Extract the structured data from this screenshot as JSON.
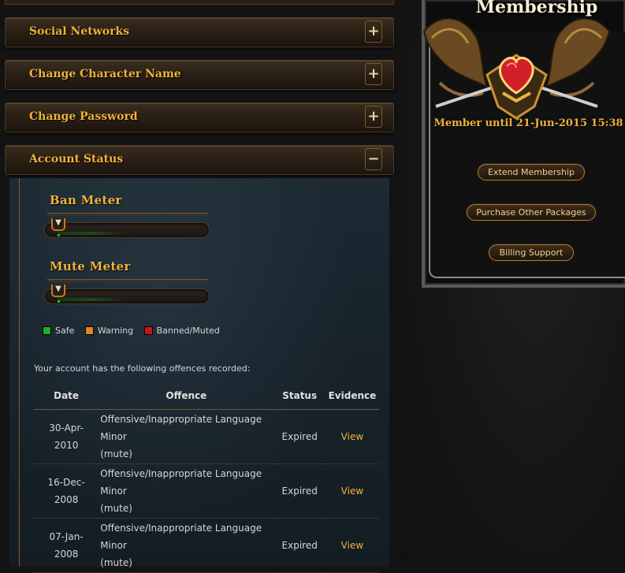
{
  "sections": [
    {
      "label": "Social Networks",
      "toggle": "+"
    },
    {
      "label": "Change Character Name",
      "toggle": "+"
    },
    {
      "label": "Change Password",
      "toggle": "+"
    },
    {
      "label": "Account Status",
      "toggle": "−"
    }
  ],
  "account_status": {
    "ban_meter_title": "Ban Meter",
    "mute_meter_title": "Mute Meter",
    "ban_meter_level": "safe",
    "mute_meter_level": "safe",
    "legend": [
      {
        "label": "Safe",
        "color": "#1fae2a"
      },
      {
        "label": "Warning",
        "color": "#d98a1c"
      },
      {
        "label": "Banned/Muted",
        "color": "#c41818"
      }
    ],
    "offences_intro": "Your account has the following offences recorded:",
    "columns": [
      "Date",
      "Offence",
      "Status",
      "Evidence"
    ],
    "offences": [
      {
        "date_line1": "30-Apr-",
        "date_line2": "2010",
        "offence_line1": "Offensive/Inappropriate Language Minor",
        "offence_line2": "(mute)",
        "status": "Expired",
        "evidence": "View"
      },
      {
        "date_line1": "16-Dec-",
        "date_line2": "2008",
        "offence_line1": "Offensive/Inappropriate Language Minor",
        "offence_line2": "(mute)",
        "status": "Expired",
        "evidence": "View"
      },
      {
        "date_line1": "07-Jan-",
        "date_line2": "2008",
        "offence_line1": "Offensive/Inappropriate Language Minor",
        "offence_line2": "(mute)",
        "status": "Expired",
        "evidence": "View"
      }
    ]
  },
  "membership": {
    "title": "Membership",
    "member_until": "Member until 21-Jun-2015 15:38",
    "buttons": {
      "extend": "Extend Membership",
      "purchase": "Purchase Other Packages",
      "billing": "Billing Support"
    }
  },
  "colors": {
    "accent_gold": "#f0b23a",
    "panel_bg": "#18232b",
    "emblem_red": "#d0202a"
  }
}
